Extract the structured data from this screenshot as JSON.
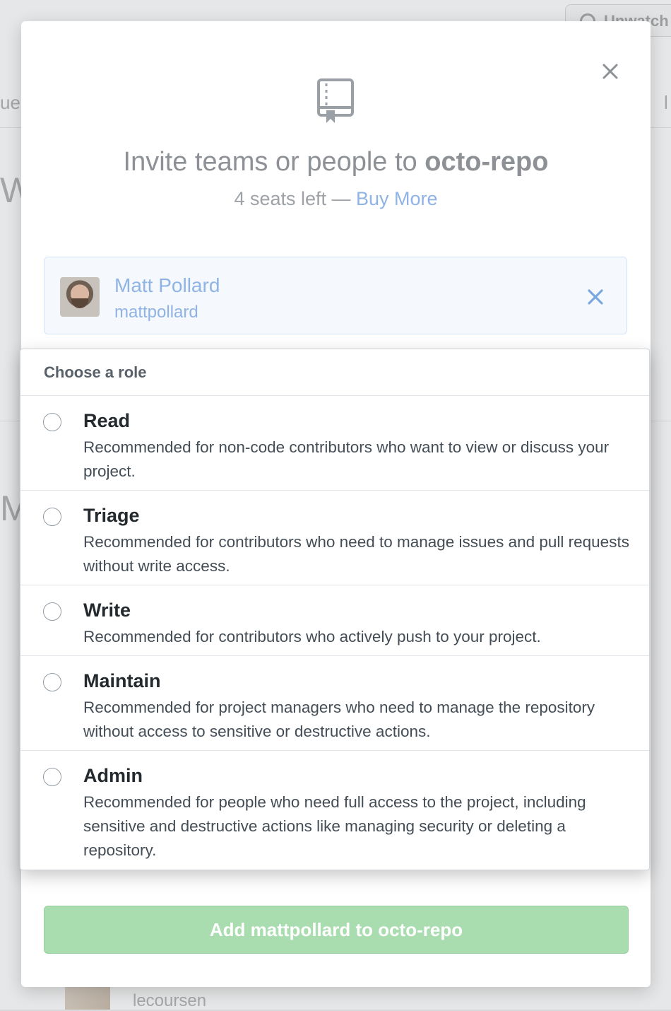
{
  "background": {
    "watch_button_label": "Unwatch",
    "left_fragments": [
      "ue",
      "W",
      "M"
    ],
    "right_fragment": "l",
    "bottom_login": "lecoursen"
  },
  "modal": {
    "title_prefix": "Invite teams or people to ",
    "repo_name": "octo-repo",
    "seats_text": "4 seats left — ",
    "buy_more_label": "Buy More",
    "icons": {
      "repo": "repo-icon",
      "close": "close-icon",
      "remove": "close-icon"
    }
  },
  "selected_user": {
    "name": "Matt Pollard",
    "login": "mattpollard"
  },
  "role_menu": {
    "header": "Choose a role",
    "roles": [
      {
        "name": "Read",
        "description": "Recommended for non-code contributors who want to view or discuss your project.",
        "selected": false
      },
      {
        "name": "Triage",
        "description": "Recommended for contributors who need to manage issues and pull requests without write access.",
        "selected": false
      },
      {
        "name": "Write",
        "description": "Recommended for contributors who actively push to your project.",
        "selected": false
      },
      {
        "name": "Maintain",
        "description": "Recommended for project managers who need to manage the repository without access to sensitive or destructive actions.",
        "selected": false
      },
      {
        "name": "Admin",
        "description": "Recommended for people who need full access to the project, including sensitive and destructive actions like managing security or deleting a repository.",
        "selected": false
      }
    ]
  },
  "add_button_label": "Add mattpollard to octo-repo",
  "colors": {
    "link": "#8fb3e4",
    "add_button": "#a9dcaf",
    "title": "#8d9196"
  }
}
